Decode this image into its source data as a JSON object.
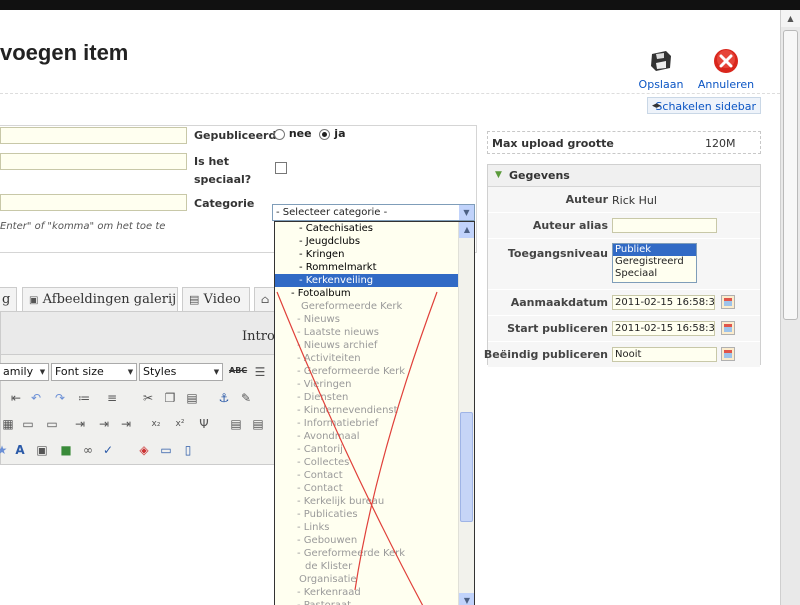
{
  "page_title": "voegen item",
  "toolbar": {
    "save_label": "Opslaan",
    "cancel_label": "Annuleren",
    "toggle_sidebar_label": "Schakelen sidebar"
  },
  "form": {
    "published_label": "Gepubliceerd",
    "published_no": "nee",
    "published_yes": "ja",
    "special_label_1": "Is het",
    "special_label_2": "speciaal?",
    "category_label": "Categorie",
    "category_value": "- Selecteer categorie -",
    "tags_hint": "Enter\" of \"komma\" om het toe te"
  },
  "category_options": [
    {
      "label": "- Catechisaties",
      "disabled": false
    },
    {
      "label": "- Jeugdclubs",
      "disabled": false
    },
    {
      "label": "- Kringen",
      "disabled": false
    },
    {
      "label": "- Rommelmarkt",
      "disabled": false
    },
    {
      "label": "- Kerkenveiling",
      "disabled": false,
      "selected": true
    },
    {
      "label": "- Fotoalbum",
      "disabled": false
    },
    {
      "label": "Gereformeerde Kerk",
      "disabled": true
    },
    {
      "label": "- Nieuws",
      "disabled": true
    },
    {
      "label": "- Laatste nieuws",
      "disabled": true
    },
    {
      "label": "- Nieuws archief",
      "disabled": true
    },
    {
      "label": "- Activiteiten",
      "disabled": true
    },
    {
      "label": "- Gereformeerde Kerk",
      "disabled": true
    },
    {
      "label": "- Vieringen",
      "disabled": true
    },
    {
      "label": "- Diensten",
      "disabled": true
    },
    {
      "label": "- Kindernevendienst",
      "disabled": true
    },
    {
      "label": "- Informatiebrief",
      "disabled": true
    },
    {
      "label": "- Avondmaal",
      "disabled": true
    },
    {
      "label": "- Cantorij",
      "disabled": true
    },
    {
      "label": "- Collectes",
      "disabled": true
    },
    {
      "label": "- Contact",
      "disabled": true
    },
    {
      "label": "- Contact",
      "disabled": true
    },
    {
      "label": "- Kerkelijk bureau",
      "disabled": true
    },
    {
      "label": "- Publicaties",
      "disabled": true
    },
    {
      "label": "- Links",
      "disabled": true
    },
    {
      "label": "- Gebouwen",
      "disabled": true
    },
    {
      "label": "- Gereformeerde Kerk",
      "disabled": true
    },
    {
      "label": "de Klister",
      "disabled": true
    },
    {
      "label": "Organisatie",
      "disabled": true
    },
    {
      "label": "- Kerkenraad",
      "disabled": true
    },
    {
      "label": "- Pastoraat",
      "disabled": true
    }
  ],
  "tabs": {
    "first_partial": "g",
    "gallery": "Afbeeldingen galerij",
    "video": "Video"
  },
  "editor": {
    "intro_label": "Intro",
    "font_family": "amily",
    "font_size": "Font size",
    "styles": "Styles",
    "spell_label": "ABC"
  },
  "sidebar": {
    "max_upload_label": "Max upload grootte",
    "max_upload_value": "120M",
    "gegevens_title": "Gegevens",
    "author_label": "Auteur",
    "author_value": "Rick Hul",
    "author_alias_label": "Auteur alias",
    "author_alias_value": "",
    "access_label": "Toegangsniveau",
    "access_options": [
      "Publiek",
      "Geregistreerd",
      "Speciaal"
    ],
    "access_selected": "Publiek",
    "created_label": "Aanmaakdatum",
    "created_value": "2011-02-15 16:58:34",
    "start_label": "Start publiceren",
    "start_value": "2011-02-15 16:58:34",
    "end_label": "Beëindig publiceren",
    "end_value": "Nooit"
  },
  "colors": {
    "link_blue": "#0b55c4",
    "selected_blue": "#316ac5",
    "field_yellow": "#fffff0",
    "cross_red": "#e0403a"
  }
}
